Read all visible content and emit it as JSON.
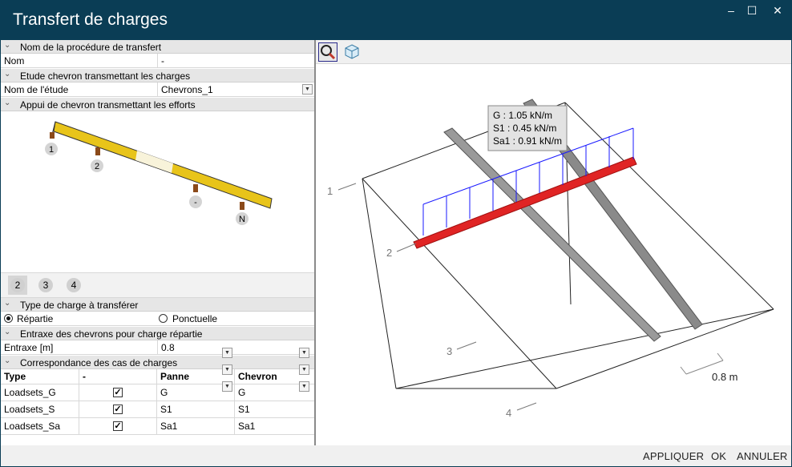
{
  "window": {
    "title": "Transfert de charges",
    "controls": [
      "–",
      "☐",
      "✕"
    ]
  },
  "sections": {
    "procedure": {
      "header": "Nom de la procédure de transfert",
      "label": "Nom",
      "value": "-"
    },
    "study": {
      "header": "Etude chevron transmettant les charges",
      "label": "Nom de l'étude",
      "value": "Chevrons_1"
    },
    "support": {
      "header": "Appui de chevron transmettant les efforts",
      "markers": [
        "1",
        "2",
        "-",
        "N"
      ]
    },
    "tabs": [
      "2",
      "3",
      "4"
    ],
    "load_type": {
      "header": "Type de charge à transférer",
      "option_1": "Répartie",
      "option_2": "Ponctuelle",
      "selected": "Répartie"
    },
    "spacing": {
      "header": "Entraxe des chevrons pour charge répartie",
      "label": "Entraxe  [m]",
      "value": "0.8"
    },
    "mapping": {
      "header": "Correspondance des cas de charges",
      "columns": [
        "Type",
        "-",
        "Panne",
        "Chevron"
      ],
      "rows": [
        {
          "type": "Loadsets_G",
          "checked": true,
          "panne": "G",
          "chevron": "G"
        },
        {
          "type": "Loadsets_S",
          "checked": true,
          "panne": "S1",
          "chevron": "S1"
        },
        {
          "type": "Loadsets_Sa",
          "checked": true,
          "panne": "Sa1",
          "chevron": "Sa1"
        }
      ]
    }
  },
  "viewer": {
    "toolbar": [
      "zoom-icon",
      "cube-view-icon"
    ],
    "tooltip": [
      "G : 1.05 kN/m",
      "S1 : 0.45 kN/m",
      "Sa1 : 0.91 kN/m"
    ],
    "labels": {
      "p1": "1",
      "p2": "2",
      "p3": "3",
      "p4": "4",
      "dim": "0.8 m"
    },
    "colors": {
      "beam": "#e02424",
      "rafter": "#888888",
      "load": "#1a1aff"
    }
  },
  "footer": {
    "apply": "APPLIQUER",
    "ok": "OK",
    "cancel": "ANNULER"
  }
}
